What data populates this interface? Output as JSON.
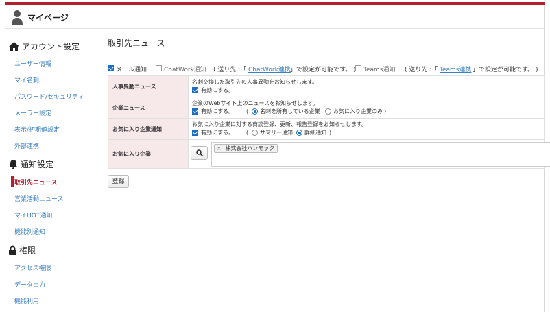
{
  "header": {
    "title": "マイページ",
    "icon": "user-icon"
  },
  "sidebar": {
    "account": {
      "title": "アカウント設定",
      "icon": "home-icon",
      "items": [
        "ユーザー情報",
        "マイ名刺",
        "パスワード/セキュリティ",
        "メーラー設定",
        "表示/初期値設定",
        "外部連携"
      ]
    },
    "notify": {
      "title": "通知設定",
      "icon": "bell-icon",
      "items": [
        "取引先ニュース",
        "営業活動ニュース",
        "マイHOT通知",
        "機能別通知"
      ],
      "active_index": 0
    },
    "perm": {
      "title": "権限",
      "icon": "lock-icon",
      "items": [
        "アクセス権限",
        "データ出力",
        "機能利用"
      ]
    }
  },
  "main": {
    "title": "取引先ニュース",
    "options": {
      "mail": {
        "label": "メール通知",
        "checked": true
      },
      "chatwork": {
        "label": "ChatWork通知",
        "checked": false
      },
      "chatwork_note_pre": "( 送り先 :「",
      "chatwork_link": "ChatWork連携",
      "chatwork_note_post": "」で設定が可能です。 )",
      "teams": {
        "label": "Teams通知",
        "checked": false
      },
      "teams_note_pre": "( 送り先 :「",
      "teams_link": "Teams連携",
      "teams_note_post": "」で設定が可能です。 )"
    },
    "rows": {
      "jinji": {
        "label": "人事異動ニュース",
        "desc": "名刺交換した取引先の人事異動をお知らせします。",
        "enable": "有効にする。"
      },
      "kigyo": {
        "label": "企業ニュース",
        "desc": "企業のWebサイト上のニュースをお知らせします。",
        "enable": "有効にする。",
        "paren_open": "(",
        "radio1": "名刺を所有している企業",
        "radio2": "お気に入り企業のみ",
        "paren_close": ")"
      },
      "fav_notify": {
        "label": "お気に入り企業通知",
        "desc": "お気に入り企業に対する商談登録、更新、報告登録をお知らせします。",
        "enable": "有効にする。",
        "paren_open": "(",
        "radio1": "サマリー通知",
        "radio2": "詳細通知",
        "paren_close": ")"
      },
      "fav": {
        "label": "お気に入り企業",
        "tag_x": "×",
        "tag": "株式会社ハンモック"
      }
    },
    "save_label": "登録"
  }
}
